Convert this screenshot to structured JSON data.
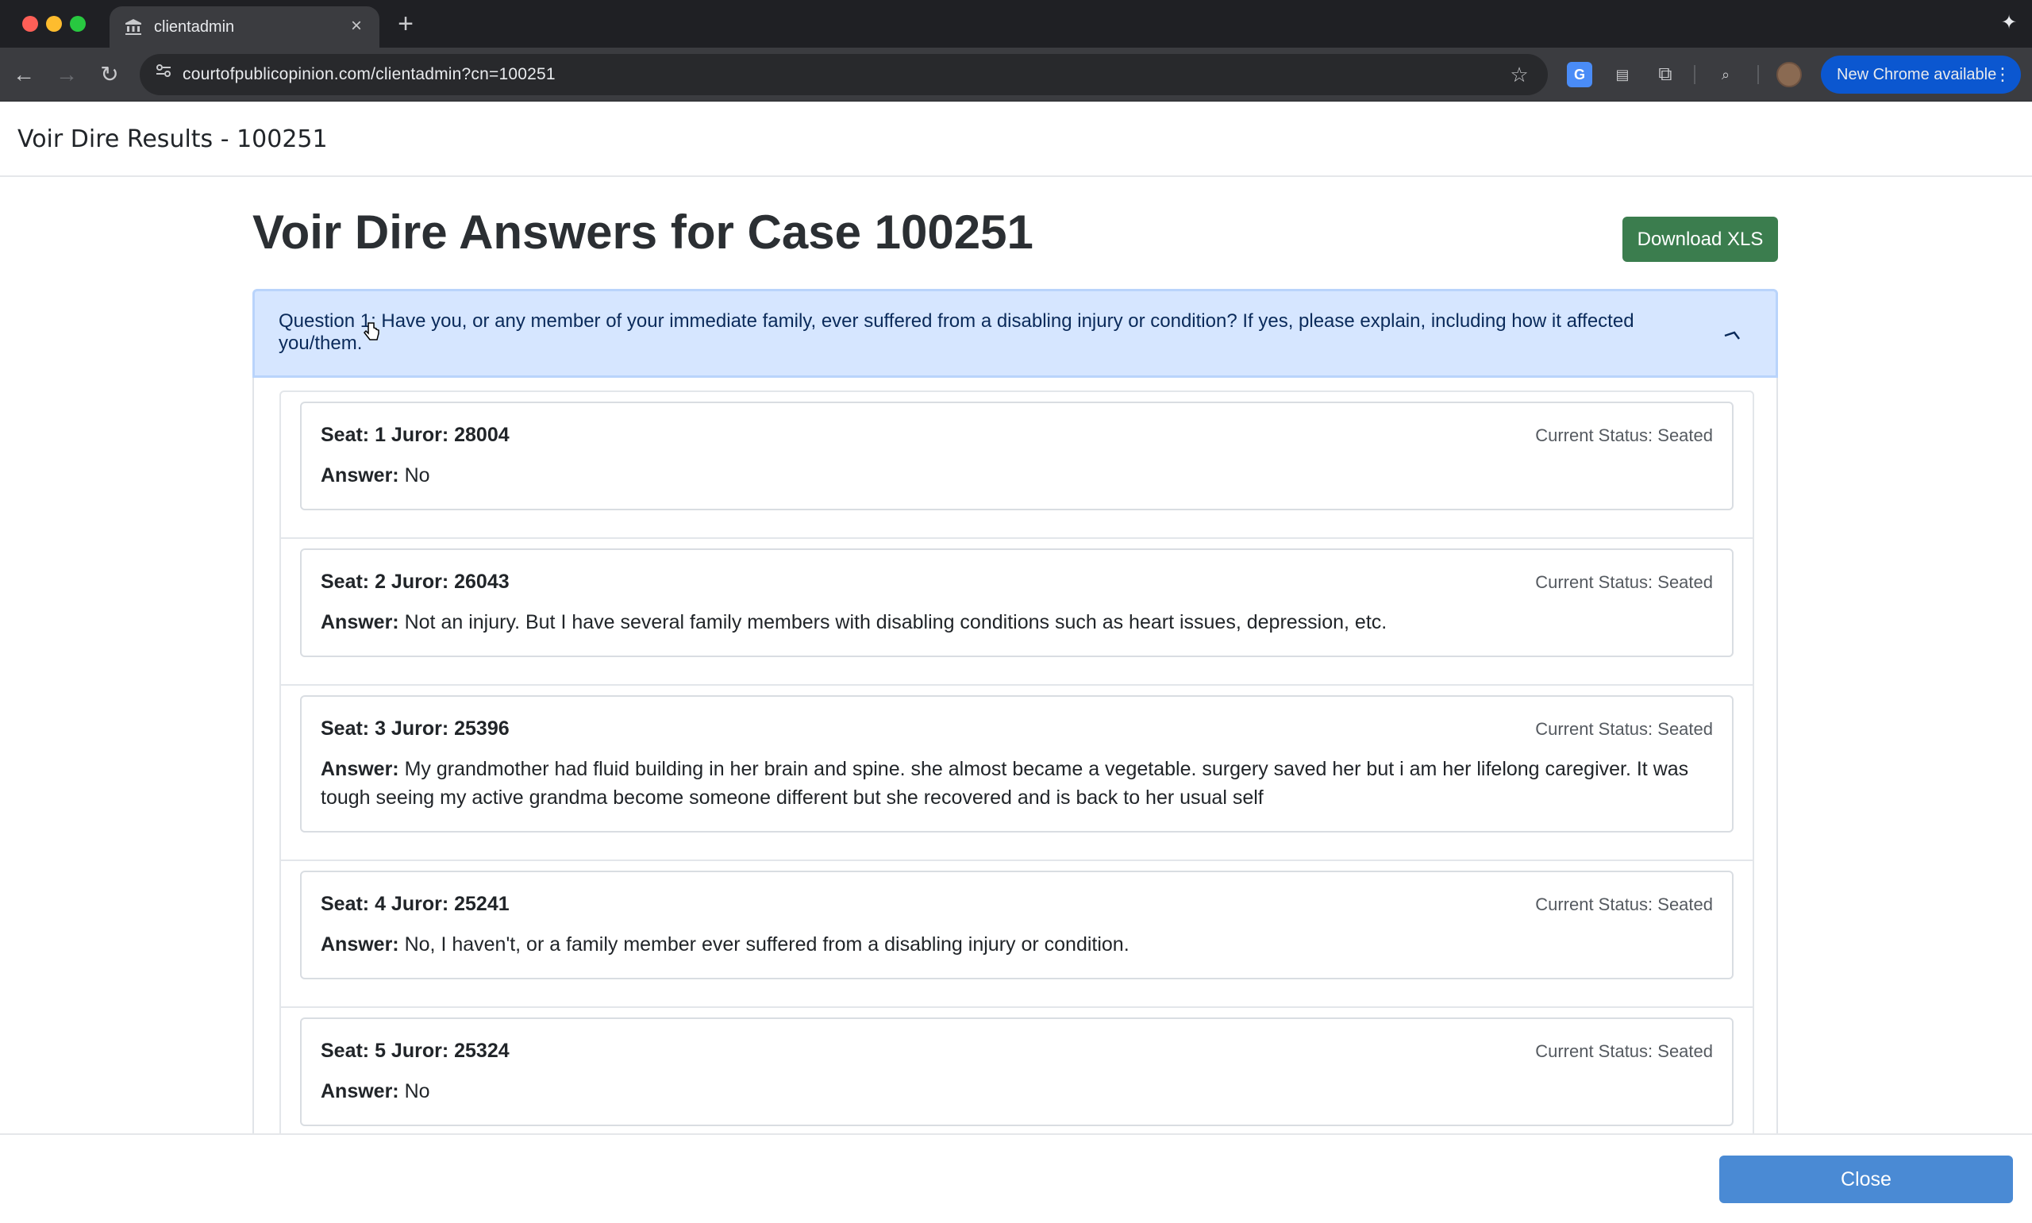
{
  "browser": {
    "tab_title": "clientadmin",
    "url": "courtofpublicopinion.com/clientadmin?cn=100251",
    "update_label": "New Chrome available"
  },
  "modal": {
    "title": "Voir Dire Results - 100251",
    "close_label": "Close"
  },
  "content": {
    "heading": "Voir Dire Answers for Case 100251",
    "download_label": "Download XLS"
  },
  "question": {
    "text": "Question 1: Have you, or any member of your immediate family, ever suffered from a disabling injury or condition? If yes, please explain, including how it affected you/them."
  },
  "answer_label": "Answer:",
  "jurors": [
    {
      "seat_line": "Seat: 1 Juror: 28004",
      "status": "Current Status: Seated",
      "answer": "No"
    },
    {
      "seat_line": "Seat: 2 Juror: 26043",
      "status": "Current Status: Seated",
      "answer": "Not an injury. But I have several family members with disabling conditions such as heart issues, depression, etc."
    },
    {
      "seat_line": "Seat: 3 Juror: 25396",
      "status": "Current Status: Seated",
      "answer": "My grandmother had fluid building in her brain and spine. she almost became a vegetable. surgery saved her but i am her lifelong caregiver. It was tough seeing my active grandma become someone different but she recovered and is back to her usual self"
    },
    {
      "seat_line": "Seat: 4 Juror: 25241",
      "status": "Current Status: Seated",
      "answer": "No, I haven't, or a family member ever suffered from a disabling injury or condition."
    },
    {
      "seat_line": "Seat: 5 Juror: 25324",
      "status": "Current Status: Seated",
      "answer": "No"
    }
  ]
}
